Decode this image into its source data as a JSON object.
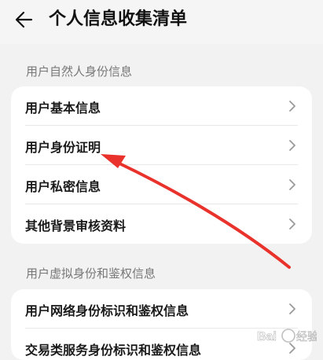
{
  "header": {
    "title": "个人信息收集清单",
    "back_icon": "arrow-left-icon"
  },
  "sections": [
    {
      "title": "用户自然人身份信息",
      "items": [
        {
          "label": "用户基本信息"
        },
        {
          "label": "用户身份证明"
        },
        {
          "label": "用户私密信息"
        },
        {
          "label": "其他背景审核资料"
        }
      ]
    },
    {
      "title": "用户虚拟身份和鉴权信息",
      "items": [
        {
          "label": "用户网络身份标识和鉴权信息"
        },
        {
          "label": "交易类服务身份标识和鉴权信息"
        }
      ]
    }
  ],
  "annotation": {
    "color": "#e8322b"
  },
  "colors": {
    "background": "#f2f2f2",
    "card": "#ffffff",
    "text": "#1a1a1a",
    "section_text": "#777777"
  }
}
